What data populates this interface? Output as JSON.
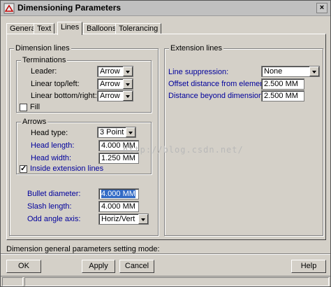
{
  "window": {
    "title": "Dimensioning Parameters",
    "close_glyph": "×"
  },
  "tabs": [
    {
      "label": "General",
      "active": false
    },
    {
      "label": "Text",
      "active": false
    },
    {
      "label": "Lines",
      "active": true
    },
    {
      "label": "Balloons",
      "active": false
    },
    {
      "label": "Tolerancing",
      "active": false
    }
  ],
  "dimension_lines": {
    "group_label": "Dimension lines",
    "terminations": {
      "group_label": "Terminations",
      "leader": {
        "label": "Leader:",
        "value": "Arrow"
      },
      "linear_top_left": {
        "label": "Linear top/left:",
        "value": "Arrow"
      },
      "linear_bottom_right": {
        "label": "Linear bottom/right:",
        "value": "Arrow"
      },
      "fill": {
        "label": "Fill",
        "checked": false
      }
    },
    "arrows": {
      "group_label": "Arrows",
      "head_type": {
        "label": "Head type:",
        "value": "3 Point"
      },
      "head_length": {
        "label": "Head length:",
        "value": "4.000 MM"
      },
      "head_width": {
        "label": "Head width:",
        "value": "1.250 MM"
      },
      "inside_extension_lines": {
        "label": "Inside extension lines",
        "checked": true
      }
    },
    "bullet_diameter": {
      "label": "Bullet diameter:",
      "value": "4.000 MM"
    },
    "slash_length": {
      "label": "Slash length:",
      "value": "4.000 MM"
    },
    "odd_angle_axis": {
      "label": "Odd angle axis:",
      "value": "Horiz/Vert"
    }
  },
  "extension_lines": {
    "group_label": "Extension lines",
    "line_suppression": {
      "label": "Line suppression:",
      "value": "None"
    },
    "offset_distance": {
      "label": "Offset distance from element:",
      "value": "2.500 MM"
    },
    "distance_beyond": {
      "label": "Distance beyond dimension line:",
      "value": "2.500 MM"
    }
  },
  "status_text": "Dimension general parameters setting mode:",
  "buttons": {
    "ok": "OK",
    "apply": "Apply",
    "cancel": "Cancel",
    "help": "Help"
  },
  "watermark": "http://blog.csdn.net/"
}
